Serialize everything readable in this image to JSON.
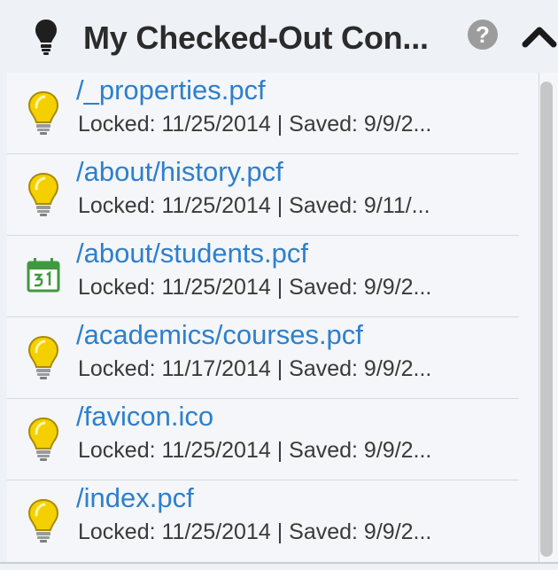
{
  "panel": {
    "title": "My Checked-Out Con...",
    "help_label": "?",
    "header_icon": "lightbulb-icon",
    "collapse_icon": "chevron-up-icon"
  },
  "items": [
    {
      "path": "/_properties.pcf",
      "meta": "Locked: 11/25/2014 | Saved: 9/9/2...",
      "icon": "lightbulb-icon"
    },
    {
      "path": "/about/history.pcf",
      "meta": "Locked: 11/25/2014 | Saved: 9/11/...",
      "icon": "lightbulb-icon"
    },
    {
      "path": "/about/students.pcf",
      "meta": "Locked: 11/25/2014 | Saved: 9/9/2...",
      "icon": "calendar-icon"
    },
    {
      "path": "/academics/courses.pcf",
      "meta": "Locked: 11/17/2014 | Saved: 9/9/2...",
      "icon": "lightbulb-icon"
    },
    {
      "path": "/favicon.ico",
      "meta": "Locked: 11/25/2014 | Saved: 9/9/2...",
      "icon": "lightbulb-icon"
    },
    {
      "path": "/index.pcf",
      "meta": "Locked: 11/25/2014 | Saved: 9/9/2...",
      "icon": "lightbulb-icon"
    }
  ],
  "colors": {
    "link": "#2e7fcc",
    "bulb": "#f5d000",
    "calendar": "#3f9a3f"
  }
}
